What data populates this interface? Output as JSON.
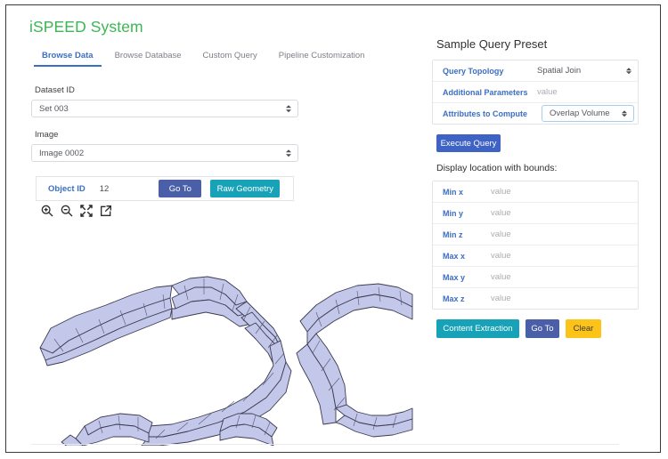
{
  "app": {
    "title": "iSPEED System",
    "title_color": "#3cb554"
  },
  "tabs": [
    {
      "label": "Browse Data",
      "active": true
    },
    {
      "label": "Browse Database",
      "active": false
    },
    {
      "label": "Custom Query",
      "active": false
    },
    {
      "label": "Pipeline Customization",
      "active": false
    }
  ],
  "browse": {
    "dataset": {
      "label": "Dataset ID",
      "value": "Set 003"
    },
    "image": {
      "label": "Image",
      "value": "Image 0002"
    },
    "object": {
      "label": "Object ID",
      "value": "12",
      "goto_label": "Go To",
      "raw_geometry_label": "Raw Geometry"
    },
    "viewer_icons": [
      "zoom-in-icon",
      "zoom-out-icon",
      "expand-icon",
      "popout-icon"
    ]
  },
  "query_preset": {
    "title": "Sample Query Preset",
    "rows": [
      {
        "label": "Query Topology",
        "value": "Spatial Join",
        "kind": "select"
      },
      {
        "label": "Additional Parameters",
        "value": "value",
        "kind": "placeholder"
      },
      {
        "label": "Attributes to Compute",
        "value": "Overlap Volume",
        "kind": "focused-select"
      }
    ],
    "execute_label": "Execute Query"
  },
  "bounds": {
    "title": "Display location with bounds:",
    "rows": [
      {
        "label": "Min x",
        "value": "value"
      },
      {
        "label": "Min y",
        "value": "value"
      },
      {
        "label": "Min z",
        "value": "value"
      },
      {
        "label": "Max x",
        "value": "value"
      },
      {
        "label": "Max y",
        "value": "value"
      },
      {
        "label": "Max z",
        "value": "value"
      }
    ],
    "actions": [
      {
        "label": "Content Extraction",
        "style": "teal"
      },
      {
        "label": "Go To",
        "style": "indigo"
      },
      {
        "label": "Clear",
        "style": "amber"
      }
    ]
  },
  "colors": {
    "accent_blue": "#3b6fc4",
    "indigo": "#4a5fa8",
    "teal": "#17a2b8",
    "amber": "#fcc419",
    "green": "#3cb554",
    "mesh_fill": "#c3c7ea",
    "mesh_edge": "#3b3b50"
  }
}
